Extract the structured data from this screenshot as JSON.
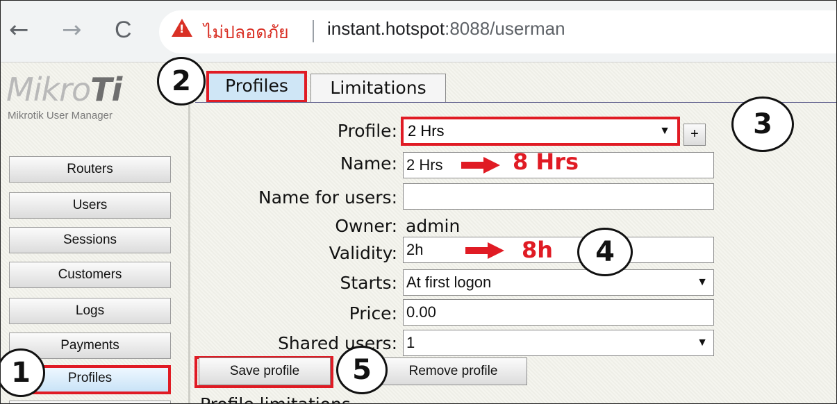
{
  "browser": {
    "nav": {
      "back": "←",
      "forward": "→",
      "reload": "C"
    },
    "security_warning": "ไม่ปลอดภัย",
    "url_host": "instant.hotspot",
    "url_rest": ":8088/userman"
  },
  "sidebar": {
    "logo_light": "Mikro",
    "logo_bold": "Ti",
    "logo_subtitle": "Mikrotik User Manager",
    "items": [
      {
        "label": "Routers"
      },
      {
        "label": "Users"
      },
      {
        "label": "Sessions"
      },
      {
        "label": "Customers"
      },
      {
        "label": "Logs"
      },
      {
        "label": "Payments"
      },
      {
        "label": "Profiles"
      }
    ]
  },
  "tabs": [
    {
      "label": "Profiles",
      "active": true
    },
    {
      "label": "Limitations",
      "active": false
    }
  ],
  "form": {
    "profile_label": "Profile:",
    "profile_value": "2 Hrs",
    "add_label": "+",
    "name_label": "Name:",
    "name_value": "2 Hrs",
    "name_note": "8 Hrs",
    "name_for_users_label": "Name for users:",
    "name_for_users_value": "",
    "owner_label": "Owner:",
    "owner_value": "admin",
    "validity_label": "Validity:",
    "validity_value": "2h",
    "validity_note": "8h",
    "starts_label": "Starts:",
    "starts_value": "At first logon",
    "price_label": "Price:",
    "price_value": "0.00",
    "shared_users_label": "Shared users:",
    "shared_users_value": "1"
  },
  "actions": {
    "save_label": "Save profile",
    "remove_label": "Remove profile"
  },
  "section_heading": "Profile limitations",
  "step_markers": [
    "1",
    "2",
    "3",
    "4",
    "5"
  ],
  "colors": {
    "highlight": "#e01b24",
    "warning": "#d93025",
    "active_tab": "#cfe6f6"
  }
}
